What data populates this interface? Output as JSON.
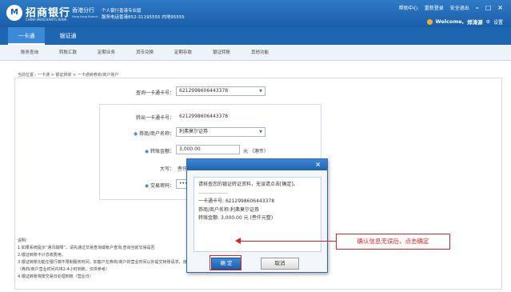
{
  "header": {
    "logo_glyph": "M",
    "bank_name": "招商银行",
    "bank_name_en": "CHINA MERCHANTS BANK",
    "branch": "香港分行",
    "branch_en": "Hong Kong Branch",
    "edition": "个人银行香港专业版",
    "service_line": "服务电话香港852-31195555 内地95555",
    "links": [
      "帮助中心",
      "重新登录",
      "安全退出"
    ],
    "window_buttons": [
      "–",
      "□",
      "×"
    ],
    "welcome": "Welcome,",
    "user_name": "郑涛源",
    "settings": "设置"
  },
  "tabs": [
    {
      "label": "一卡通",
      "active": true
    },
    {
      "label": "银证通",
      "active": false
    }
  ],
  "submenu": [
    "账务查询",
    "转账汇款",
    "定期业务",
    "货币兑换",
    "定期存款",
    "银证转账",
    "其他功能"
  ],
  "breadcrumb": "当前位置：一卡通 > 银证转账 > 一卡通转券商/商户账户",
  "form": {
    "query_label": "查询一卡通卡号：",
    "query_value": "6212998606443378",
    "out_label": "转出一卡通卡号：",
    "out_value": "6212998606443378",
    "broker_label": "券商/商户名称：",
    "broker_value": "利弗莫尔证券",
    "amount_label": "转账金额：",
    "amount_value": "3,000.00",
    "amount_unit": "元 （港币）",
    "upper_label": "大写：",
    "upper_value": "叁仟元",
    "pwd_label": "交易密码：",
    "pwd_value": "••••••"
  },
  "notes": {
    "title": "说明:",
    "lines": [
      "1.如果系统提示“通讯故障”，请先通过交易查询或帐户查询,查询当前交易是否",
      "2.银证转账不计息收费用。",
      "3.银证转账功能在银行端不限制服务时间，如客户在券商/商户的营业时间以外提交转账请求，该请求将在券商/商户开始营业后予以处理。",
      "（券商/商户营业时间内将2-4小时到账，仅供参考）",
      "4.银证转账将按交易日处理到账（营业日）"
    ]
  },
  "dialog": {
    "close": "×",
    "instruction": "请核查您的银证转证资料，无误请点击[确定]。",
    "divider": "-------------------------------",
    "card_label": "一卡通卡号:",
    "card_value": "6212998606443378",
    "broker_label": "券商/商户名称:",
    "broker_value": "利弗莫尔证券",
    "amount_label": "转账金额:",
    "amount_value": "3,000.00 元 (叁仟元整)",
    "ok": "确 定",
    "cancel": "取消"
  },
  "callout": "确认信息无误后，点击确定",
  "colors": {
    "brand": "#1a5ea8",
    "accent": "#d22222"
  }
}
